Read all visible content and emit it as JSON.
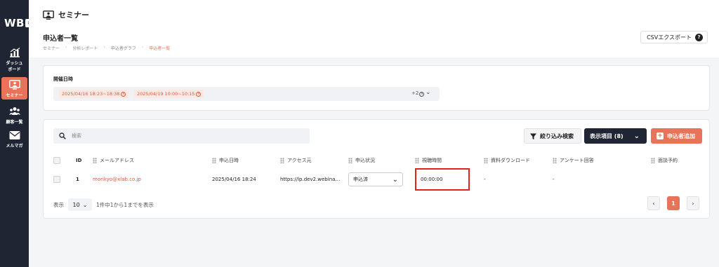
{
  "sidebar": {
    "logo": "WB",
    "logo_arrow": "»",
    "items": [
      {
        "label_line1": "ダッシュ",
        "label_line2": "ボード",
        "icon": "chart-icon"
      },
      {
        "label_line1": "セミナー",
        "label_line2": "",
        "icon": "presentation-icon",
        "active": true
      },
      {
        "label_line1": "顧客一覧",
        "label_line2": "",
        "icon": "users-icon"
      },
      {
        "label_line1": "メルマガ",
        "label_line2": "",
        "icon": "mail-icon"
      }
    ]
  },
  "topbar": {
    "title": "セミナー"
  },
  "header": {
    "page_title": "申込者一覧",
    "breadcrumb": [
      "セミナー",
      "分析レポート",
      "申込者グラフ",
      "申込者一覧"
    ],
    "csv_button": "CSVエクスポート",
    "help": "?"
  },
  "filter": {
    "label": "開催日時",
    "chips": [
      "2025/04/16 18:23~18:38",
      "2025/04/19 10:00~10:15"
    ],
    "chip_close": "×",
    "more": "+2"
  },
  "toolbar": {
    "search_placeholder": "検索",
    "filter_button": "絞り込み検索",
    "columns_button": "表示項目 (8)",
    "add_button": "申込者追加"
  },
  "table": {
    "columns": [
      "ID",
      "メールアドレス",
      "申込日時",
      "アクセス元",
      "申込状況",
      "視聴時間",
      "資料ダウンロード",
      "アンケート回答",
      "面談予約"
    ],
    "rows": [
      {
        "id": "1",
        "email": "morikyo@xlab.co.jp",
        "applied_at": "2025/04/16 18:24",
        "source": "https://lp.dev2.webina…",
        "status": "申込済",
        "watch_time": "00:00:00",
        "download": "-",
        "survey": "-",
        "meeting": ""
      }
    ]
  },
  "pagination": {
    "label": "表示",
    "page_size": "10",
    "summary": "1件中1から1までを表示",
    "prev": "‹",
    "current": "1",
    "next": "›"
  },
  "colors": {
    "accent": "#e8735a",
    "sidebar": "#1f2533",
    "highlight": "#e3221b"
  }
}
